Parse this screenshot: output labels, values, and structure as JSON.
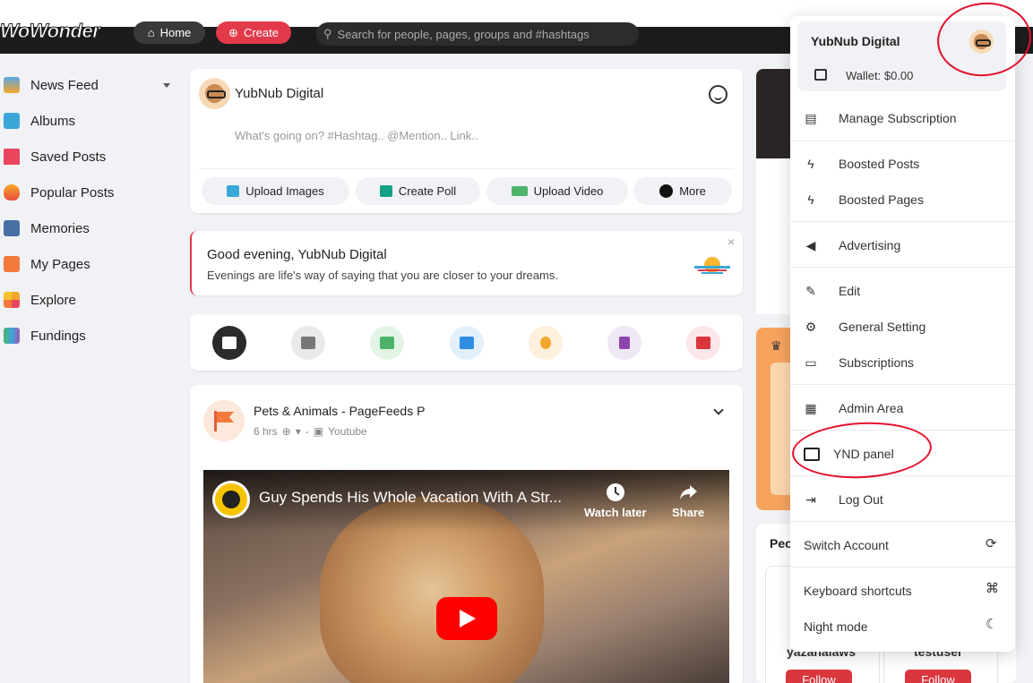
{
  "header": {
    "logo": "WoWonder",
    "home_label": "Home",
    "create_label": "Create",
    "search_placeholder": "Search for people, pages, groups and #hashtags"
  },
  "sidebar": {
    "items": [
      {
        "label": "News Feed"
      },
      {
        "label": "Albums"
      },
      {
        "label": "Saved Posts"
      },
      {
        "label": "Popular Posts"
      },
      {
        "label": "Memories"
      },
      {
        "label": "My Pages"
      },
      {
        "label": "Explore"
      },
      {
        "label": "Fundings"
      }
    ]
  },
  "composer": {
    "user_name": "YubNub Digital",
    "placeholder": "What's going on? #Hashtag.. @Mention.. Link..",
    "actions": {
      "upload_images": "Upload Images",
      "create_poll": "Create Poll",
      "upload_video": "Upload Video",
      "more": "More"
    }
  },
  "greeting": {
    "title": "Good evening, YubNub Digital",
    "subtitle": "Evenings are life's way of saying that you are closer to your dreams.",
    "close": "×"
  },
  "post": {
    "page_name": "Pets & Animals - PageFeeds P",
    "time": "6 hrs",
    "source": "Youtube",
    "video": {
      "title": "Guy Spends His Whole Vacation With A Str...",
      "watch_later": "Watch later",
      "share": "Share"
    }
  },
  "right_column": {
    "people_title": "Peo",
    "people": [
      {
        "name": "yazanalaws",
        "follow": "Follow"
      },
      {
        "name": "testuser",
        "follow": "Follow"
      }
    ]
  },
  "dropdown": {
    "profile_name": "YubNub Digital",
    "wallet": "Wallet: $0.00",
    "items": {
      "manage_subscription": "Manage Subscription",
      "boosted_posts": "Boosted Posts",
      "boosted_pages": "Boosted Pages",
      "advertising": "Advertising",
      "edit": "Edit",
      "general_setting": "General Setting",
      "subscriptions": "Subscriptions",
      "admin_area": "Admin Area",
      "ynd_panel": "YND panel",
      "log_out": "Log Out",
      "switch_account": "Switch Account",
      "keyboard_shortcuts": "Keyboard shortcuts",
      "night_mode": "Night mode"
    }
  },
  "colors": {
    "accent_red": "#e2394b",
    "annotation_red": "#e4102a",
    "header_dark": "#1c1c1e"
  }
}
